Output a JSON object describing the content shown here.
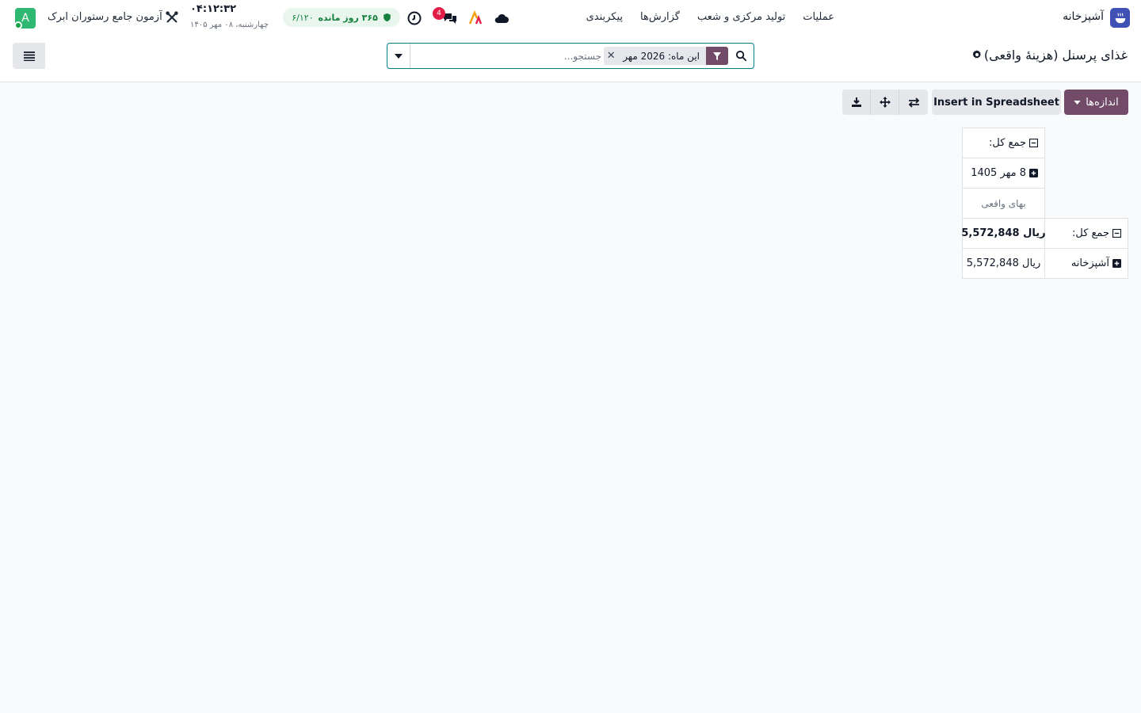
{
  "navbar": {
    "app_name": "آشپزخانه",
    "menu": [
      "عملیات",
      "تولید مرکزی و شعب",
      "گزارش‌ها",
      "پیکربندی"
    ]
  },
  "systray": {
    "avatar_letter": "A",
    "company": "آزمون جامع رستوران ابرک",
    "clock_time": "۰۴:۱۲:۳۲",
    "clock_date": "چهارشنبه، ۰۸ مهر ۱۴۰۵",
    "license_days": "۳۶۵ روز مانده",
    "license_count": "۶/۱۲۰",
    "message_badge": "4"
  },
  "control_panel": {
    "page_title": "غذای پرسنل (هزینهٔ واقعی)",
    "search": {
      "facet": "این ماه: 2026 مهر",
      "placeholder": "جستجو..."
    }
  },
  "pivot_toolbar": {
    "measures_label": "اندازه‌ها",
    "insert_label": "Insert in Spreadsheet"
  },
  "pivot": {
    "col_total_label": "جمع کل:",
    "col_group_label": "8 مهر 1405",
    "measure_label": "بهای واقعی",
    "rows": [
      {
        "label": "جمع کل:",
        "value": "ریال  5,572,848",
        "is_total": true
      },
      {
        "label": "آشپزخانه",
        "value": "ریال  5,572,848",
        "is_total": false
      }
    ]
  }
}
